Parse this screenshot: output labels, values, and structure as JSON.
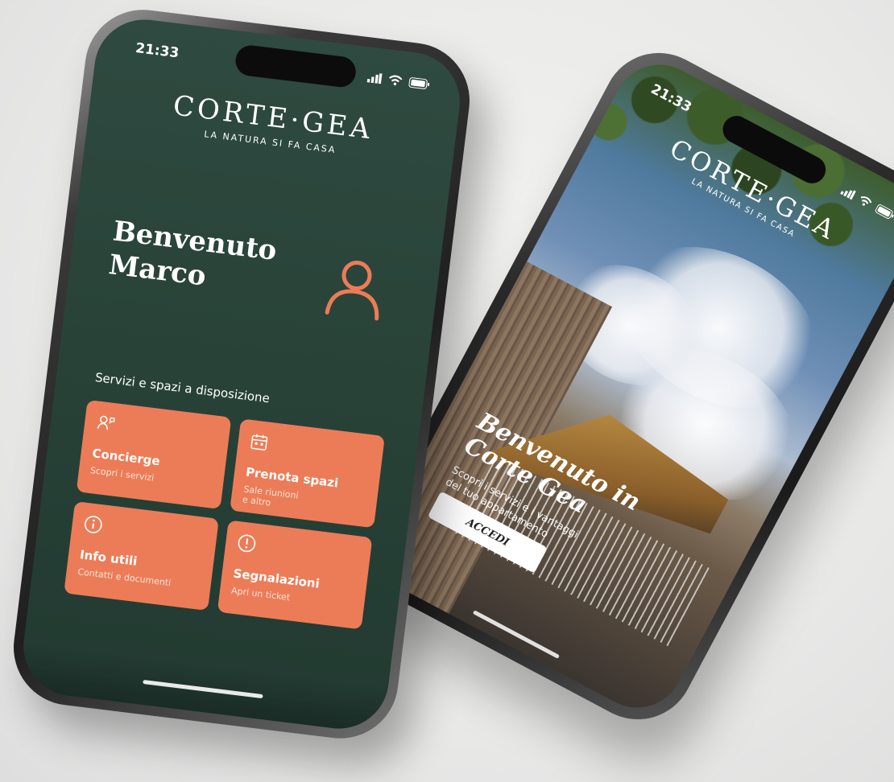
{
  "brand": {
    "name": "CORTE·GEA",
    "tagline": "LA NATURA SI FA CASA",
    "accent_color": "#ec7c57",
    "background_color": "#284238"
  },
  "front_phone": {
    "status_time": "21:33",
    "status_icons": [
      "signal-icon",
      "wifi-icon",
      "battery-icon"
    ],
    "welcome_line1": "Benvenuto",
    "welcome_line2": "Marco",
    "profile_icon": "user-icon",
    "section_label": "Servizi e spazi a disposizione",
    "tiles": [
      {
        "name": "Concierge",
        "desc": "Scopri i servizi",
        "icon": "concierge-icon"
      },
      {
        "name": "Prenota spazi",
        "desc_line1": "Sale riunioni",
        "desc_line2": "e altro",
        "icon": "calendar-icon"
      },
      {
        "name": "Info utili",
        "desc": "Contatti e documenti",
        "icon": "info-icon"
      },
      {
        "name": "Segnalazioni",
        "desc": "Apri un ticket",
        "icon": "alert-icon"
      }
    ]
  },
  "back_phone": {
    "status_time": "21:33",
    "status_icons": [
      "signal-icon",
      "wifi-icon",
      "battery-icon"
    ],
    "welcome_line1": "Benvenuto in",
    "welcome_line2": "Corte Gea",
    "subtitle_line1": "Scopri i servizi e i vantaggi",
    "subtitle_line2": "del tuo appartamento",
    "cta_label": "ACCEDI"
  }
}
